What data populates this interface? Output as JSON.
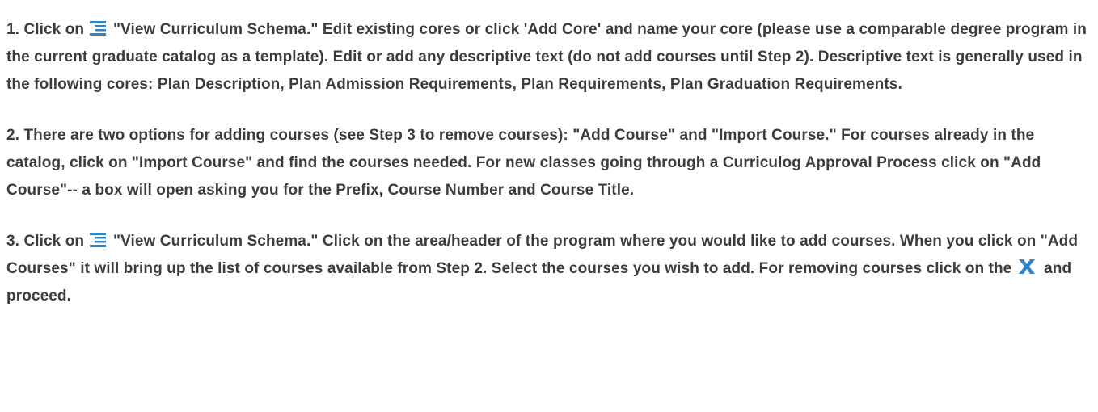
{
  "steps": [
    {
      "number": "1.",
      "click_on": "Click on",
      "icon": "list-schema-icon",
      "text_after_icon": "\"View Curriculum Schema.\" Edit existing cores or click 'Add Core' and name your core (please use a comparable degree program in the current graduate catalog as a template). Edit or add any descriptive text (do not add courses until Step 2). Descriptive text is generally used in the following cores: Plan Description, Plan Admission Requirements, Plan Requirements, Plan Graduation Requirements."
    },
    {
      "number": "2.",
      "text": "There are two options for adding courses (see Step 3 to remove courses): \"Add Course\" and \"Import Course.\" For courses already in the catalog, click on \"Import Course\" and find the courses needed. For new classes going through a Curriculog Approval Process click on \"Add Course\"-- a box will open asking you for the Prefix, Course Number and Course Title."
    },
    {
      "number": "3.",
      "click_on": "Click on",
      "icon": "list-schema-icon",
      "text_after_icon": "\"View Curriculum Schema.\" Click on the area/header of the program where you would like to add courses. When you click on \"Add Courses\" it will bring up the list of courses available from Step 2. Select the courses you wish to add. For removing courses click on the",
      "remove_icon": "remove-x-icon",
      "text_end": "and proceed."
    }
  ],
  "colors": {
    "text": "#3c3c3c",
    "icon_blue": "#2e86c9"
  }
}
